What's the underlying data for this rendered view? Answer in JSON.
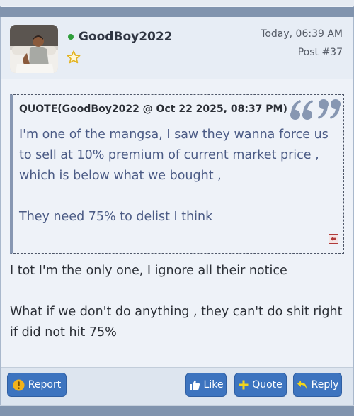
{
  "post": {
    "username": "GoodBoy2022",
    "online_status": "online",
    "timestamp": "Today, 06:39 AM",
    "post_number": "Post #37",
    "rank_icon": "star-outline-icon"
  },
  "quote": {
    "header": "QUOTE(GoodBoy2022 @ Oct 22 2025, 08:37 PM)",
    "text": "I'm one of the mangsa, I saw they wanna force us to sell at 10% premium of current market price , which is below what we bought ,\n\nThey need 75% to delist I think"
  },
  "reply": {
    "text": "I tot I'm the only one, I ignore all their notice\n\nWhat if we don't do anything , they can't do shit right if did not hit 75%"
  },
  "actions": {
    "report": "Report",
    "like": "Like",
    "quote": "Quote",
    "reply": "Reply"
  },
  "colors": {
    "button_bg": "#3d74bf",
    "quote_text": "#4b5b85",
    "online": "#2e9e3a",
    "star": "#e3b321",
    "report_icon": "#f2b21b"
  }
}
